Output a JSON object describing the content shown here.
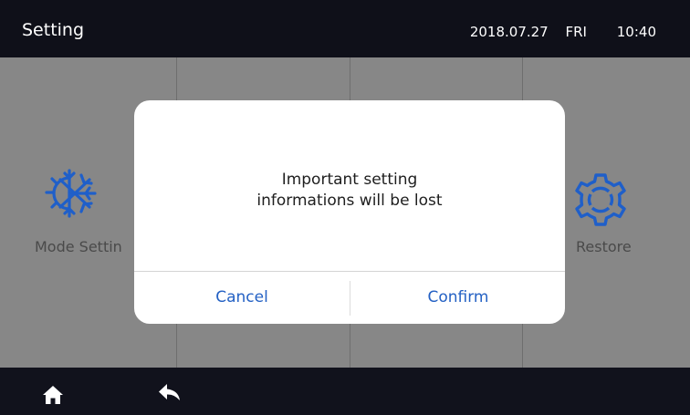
{
  "header": {
    "title": "Setting",
    "date": "2018.07.27",
    "day": "FRI",
    "time": "10:40"
  },
  "tiles": [
    {
      "label": "Mode Settin",
      "icon": "snowflake-icon"
    },
    {
      "label": "",
      "icon": ""
    },
    {
      "label": "",
      "icon": ""
    },
    {
      "label": "Restore",
      "icon": "gear-icon"
    }
  ],
  "dialog": {
    "message_line1": "Important setting",
    "message_line2": "informations will be lost",
    "cancel_label": "Cancel",
    "confirm_label": "Confirm"
  },
  "footer": {
    "home_icon": "home-icon",
    "back_icon": "back-arrow-icon"
  },
  "colors": {
    "header_bg": "#0f1019",
    "grid_bg": "#878787",
    "accent_blue": "#2461c4",
    "dialog_bg": "#ffffff"
  }
}
